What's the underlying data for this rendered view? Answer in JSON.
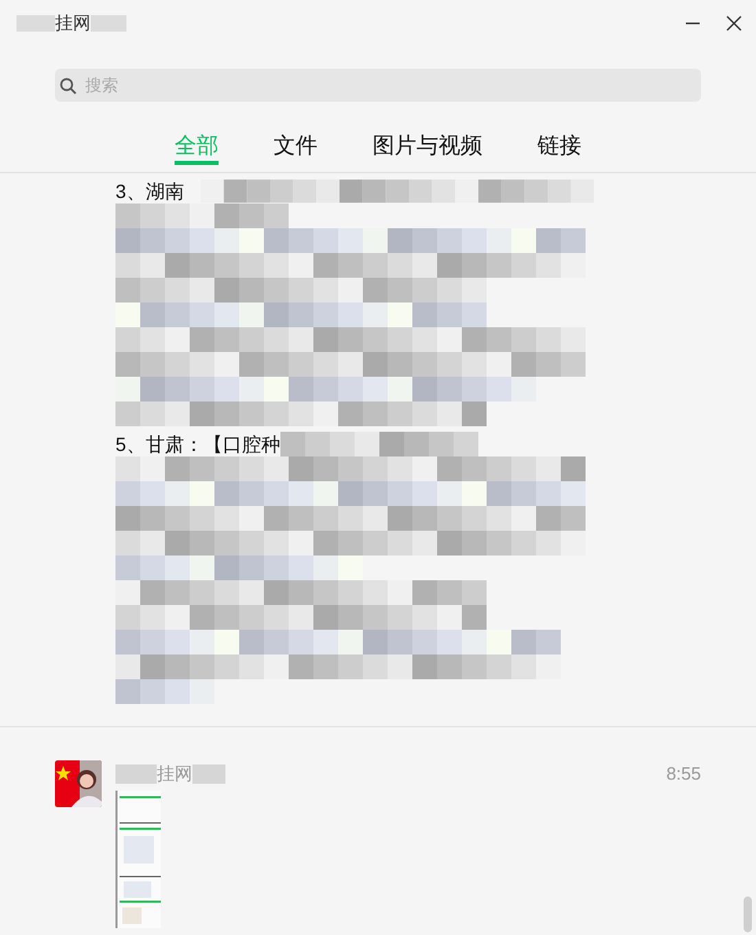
{
  "window": {
    "title": "挂网"
  },
  "search": {
    "placeholder": "搜索"
  },
  "tabs": [
    {
      "label": "全部",
      "selected": true
    },
    {
      "label": "文件",
      "selected": false
    },
    {
      "label": "图片与视频",
      "selected": false
    },
    {
      "label": "链接",
      "selected": false
    }
  ],
  "messages": [
    {
      "kind": "text",
      "lines": [
        "3、湖南",
        "5、甘肃：【口腔种"
      ]
    },
    {
      "sender": "挂网",
      "time": "8:55"
    }
  ]
}
